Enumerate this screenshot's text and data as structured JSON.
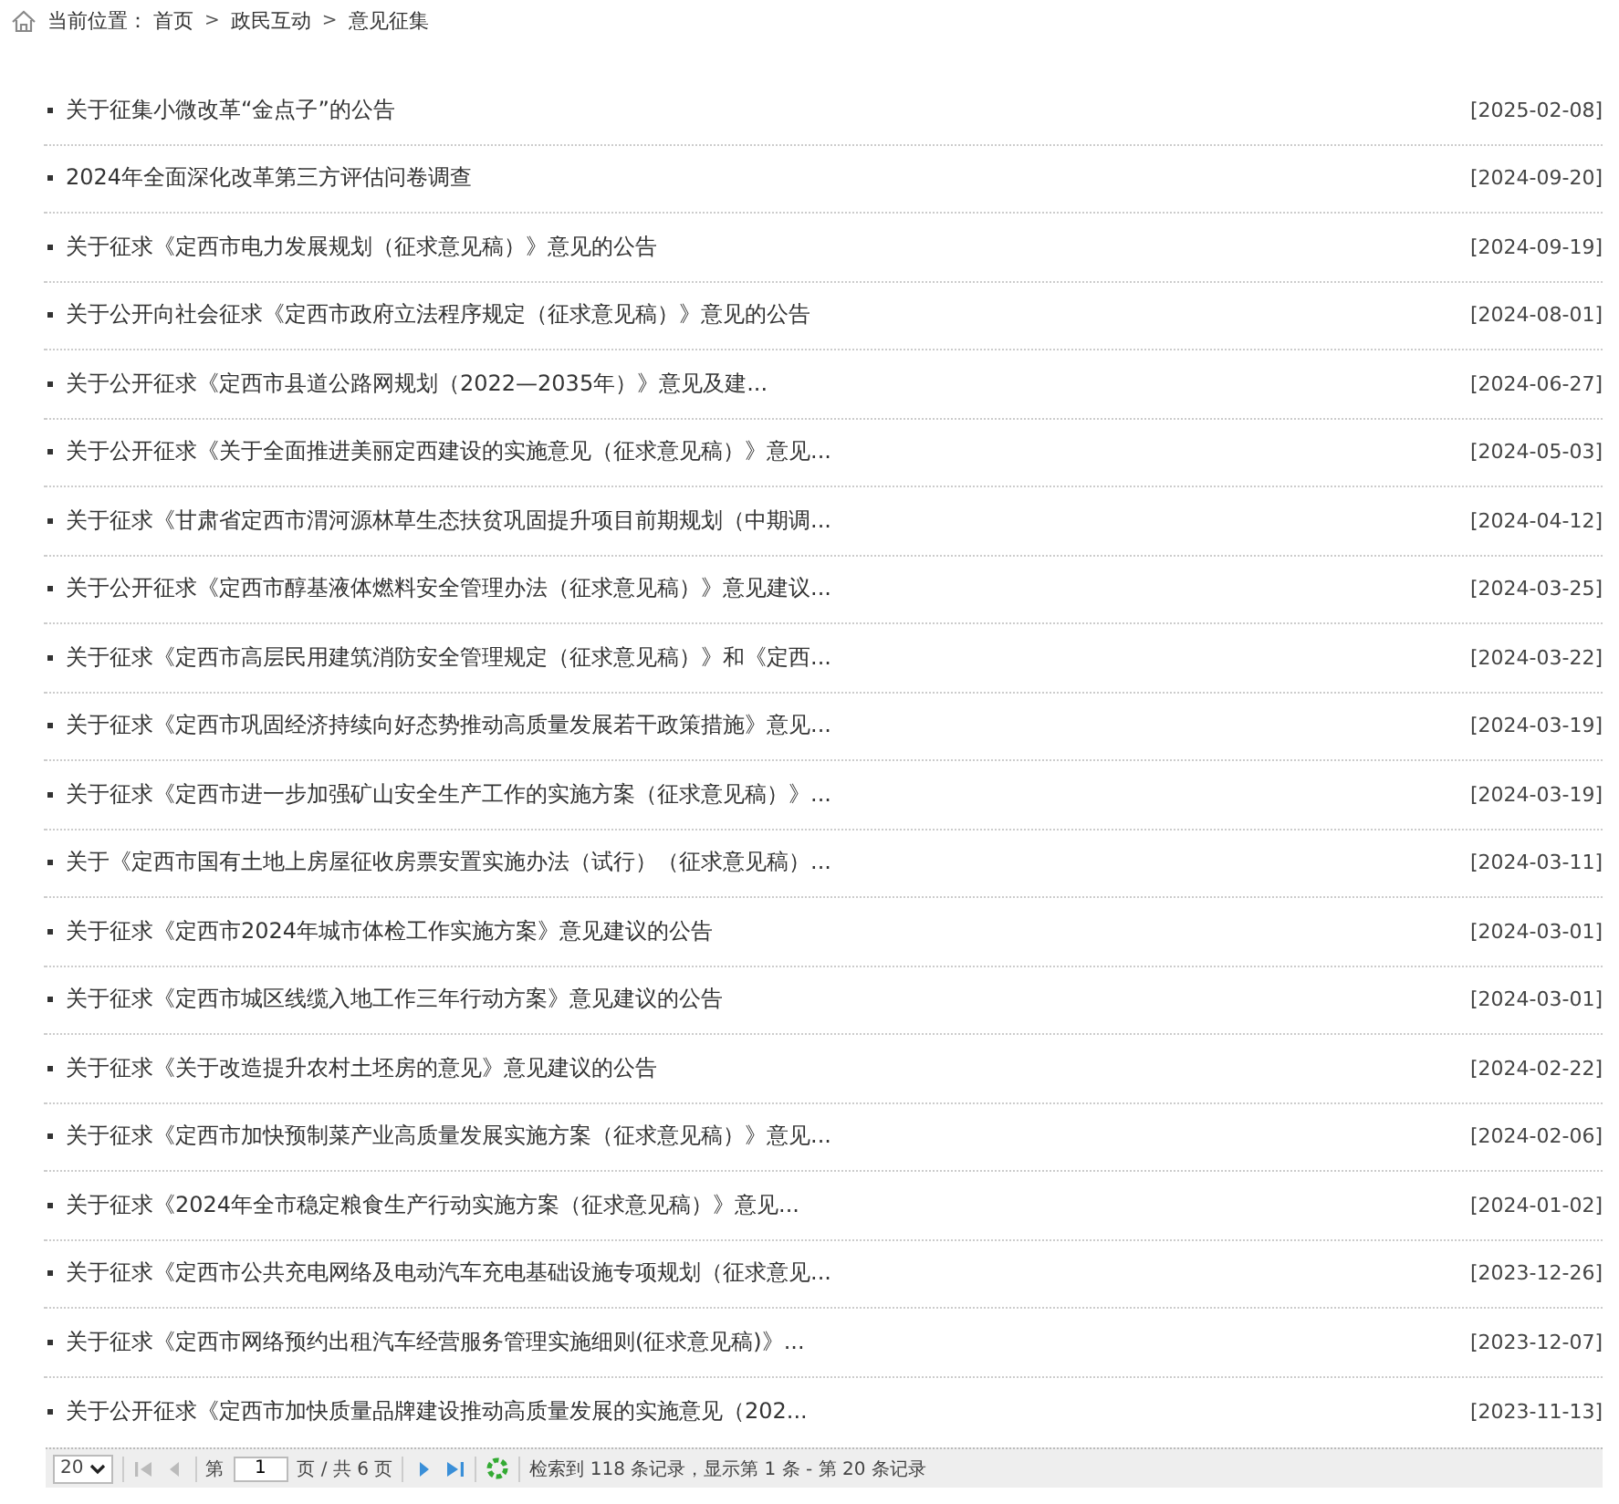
{
  "breadcrumb": {
    "label": "当前位置：",
    "items": [
      "首页",
      "政民互动",
      "意见征集"
    ],
    "separator": ">"
  },
  "articles": [
    {
      "title": "关于征集小微改革“金点子”的公告",
      "date": "[2025-02-08]"
    },
    {
      "title": "2024年全面深化改革第三方评估问卷调查",
      "date": "[2024-09-20]"
    },
    {
      "title": "关于征求《定西市电力发展规划（征求意见稿）》意见的公告",
      "date": "[2024-09-19]"
    },
    {
      "title": "关于公开向社会征求《定西市政府立法程序规定（征求意见稿）》意见的公告",
      "date": "[2024-08-01]"
    },
    {
      "title": "关于公开征求《定西市县道公路网规划（2022—2035年）》意见及建...",
      "date": "[2024-06-27]"
    },
    {
      "title": "关于公开征求《关于全面推进美丽定西建设的实施意见（征求意见稿）》意见...",
      "date": "[2024-05-03]"
    },
    {
      "title": "关于征求《甘肃省定西市渭河源林草生态扶贫巩固提升项目前期规划（中期调...",
      "date": "[2024-04-12]"
    },
    {
      "title": "关于公开征求《定西市醇基液体燃料安全管理办法（征求意见稿）》意见建议...",
      "date": "[2024-03-25]"
    },
    {
      "title": "关于征求《定西市高层民用建筑消防安全管理规定（征求意见稿）》和《定西...",
      "date": "[2024-03-22]"
    },
    {
      "title": "关于征求《定西市巩固经济持续向好态势推动高质量发展若干政策措施》意见...",
      "date": "[2024-03-19]"
    },
    {
      "title": "关于征求《定西市进一步加强矿山安全生产工作的实施方案（征求意见稿）》...",
      "date": "[2024-03-19]"
    },
    {
      "title": "关于《定西市国有土地上房屋征收房票安置实施办法（试行）（征求意见稿）...",
      "date": "[2024-03-11]"
    },
    {
      "title": "关于征求《定西市2024年城市体检工作实施方案》意见建议的公告",
      "date": "[2024-03-01]"
    },
    {
      "title": "关于征求《定西市城区线缆入地工作三年行动方案》意见建议的公告",
      "date": "[2024-03-01]"
    },
    {
      "title": "关于征求《关于改造提升农村土坯房的意见》意见建议的公告",
      "date": "[2024-02-22]"
    },
    {
      "title": "关于征求《定西市加快预制菜产业高质量发展实施方案（征求意见稿）》意见...",
      "date": "[2024-02-06]"
    },
    {
      "title": "关于征求《2024年全市稳定粮食生产行动实施方案（征求意见稿）》意见...",
      "date": "[2024-01-02]"
    },
    {
      "title": "关于征求《定西市公共充电网络及电动汽车充电基础设施专项规划（征求意见...",
      "date": "[2023-12-26]"
    },
    {
      "title": "关于征求《定西市网络预约出租汽车经营服务管理实施细则(征求意见稿)》...",
      "date": "[2023-12-07]"
    },
    {
      "title": "关于公开征求《定西市加快质量品牌建设推动高质量发展的实施意见（202...",
      "date": "[2023-11-13]"
    }
  ],
  "pager": {
    "page_size": "20",
    "first_disabled": true,
    "prev_disabled": true,
    "next_disabled": false,
    "last_disabled": false,
    "page_prefix": "第",
    "page": "1",
    "page_suffix": "页 / 共 6 页",
    "summary": "检索到 118 条记录，显示第 1 条 - 第 20 条记录"
  }
}
